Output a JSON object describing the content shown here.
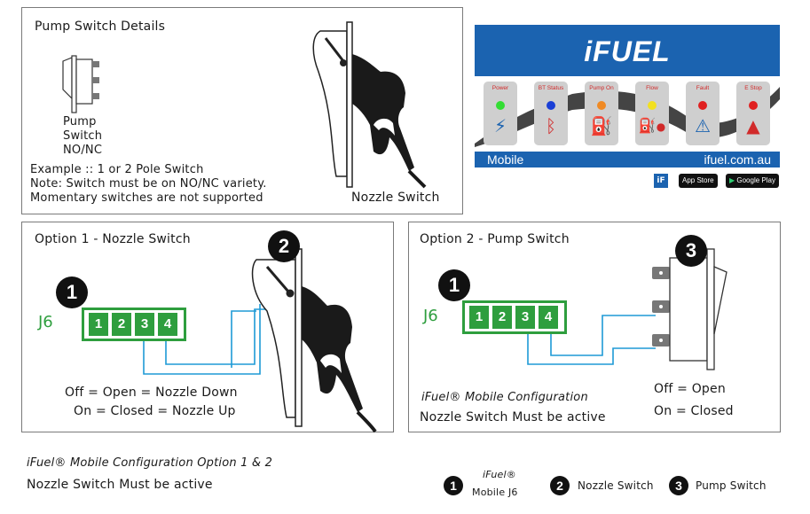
{
  "pump_details": {
    "title": "Pump Switch Details",
    "switch_label": [
      "Pump",
      "Switch",
      "NO/NC"
    ],
    "example": "Example :: 1 or 2 Pole Switch",
    "note": "Note: Switch must be on NO/NC variety.",
    "momentary": "Momentary switches are not supported",
    "nozzle_label": "Nozzle Switch"
  },
  "ifuel_card": {
    "logo": "iFUEL",
    "indicators": [
      {
        "label": "Power",
        "color": "#33dd33",
        "icon": "power-icon",
        "glyph": "⚡"
      },
      {
        "label": "BT Status",
        "color": "#1a3fd6",
        "icon": "bluetooth-icon",
        "glyph": "ᛒ"
      },
      {
        "label": "Pump On",
        "color": "#f08a24",
        "icon": "fuel-pump-icon",
        "glyph": "⛽"
      },
      {
        "label": "Flow",
        "color": "#f2e020",
        "icon": "nozzle-flow-icon",
        "glyph": "💧"
      },
      {
        "label": "Fault",
        "color": "#e02020",
        "icon": "warning-icon",
        "glyph": "⚠"
      },
      {
        "label": "E Stop",
        "color": "#e02020",
        "icon": "emergency-stop-icon",
        "glyph": "⏏"
      }
    ],
    "footer_left": "Mobile",
    "footer_right": "ifuel.com.au",
    "app_store": "App Store",
    "google_play": "Google Play",
    "brand_color": "#1b63b0"
  },
  "option1": {
    "title": "Option 1 - Nozzle Switch",
    "connector_label": "J6",
    "pins": [
      "1",
      "2",
      "3",
      "4"
    ],
    "badge_j6": "1",
    "badge_nozzle": "2",
    "line1": "Off = Open = Nozzle Down",
    "line2": "On = Closed = Nozzle Up"
  },
  "option2": {
    "title": "Option 2 - Pump Switch",
    "connector_label": "J6",
    "pins": [
      "1",
      "2",
      "3",
      "4"
    ],
    "badge_j6": "1",
    "badge_switch": "3",
    "config": "iFuel® Mobile Configuration",
    "nozzle_active": "Nozzle Switch Must be active",
    "off": "Off = Open",
    "on": "On = Closed"
  },
  "footer": {
    "config": "iFuel® Mobile Configuration Option 1 & 2",
    "nozzle_active": "Nozzle Switch Must be active",
    "legend": [
      {
        "num": "1",
        "label_a": "iFuel®",
        "label_b": "Mobile J6"
      },
      {
        "num": "2",
        "label": "Nozzle Switch"
      },
      {
        "num": "3",
        "label": "Pump Switch"
      }
    ]
  },
  "colors": {
    "connector_green": "#2e9e3e",
    "wire_blue": "#1e9ad6",
    "badge": "#111111"
  }
}
